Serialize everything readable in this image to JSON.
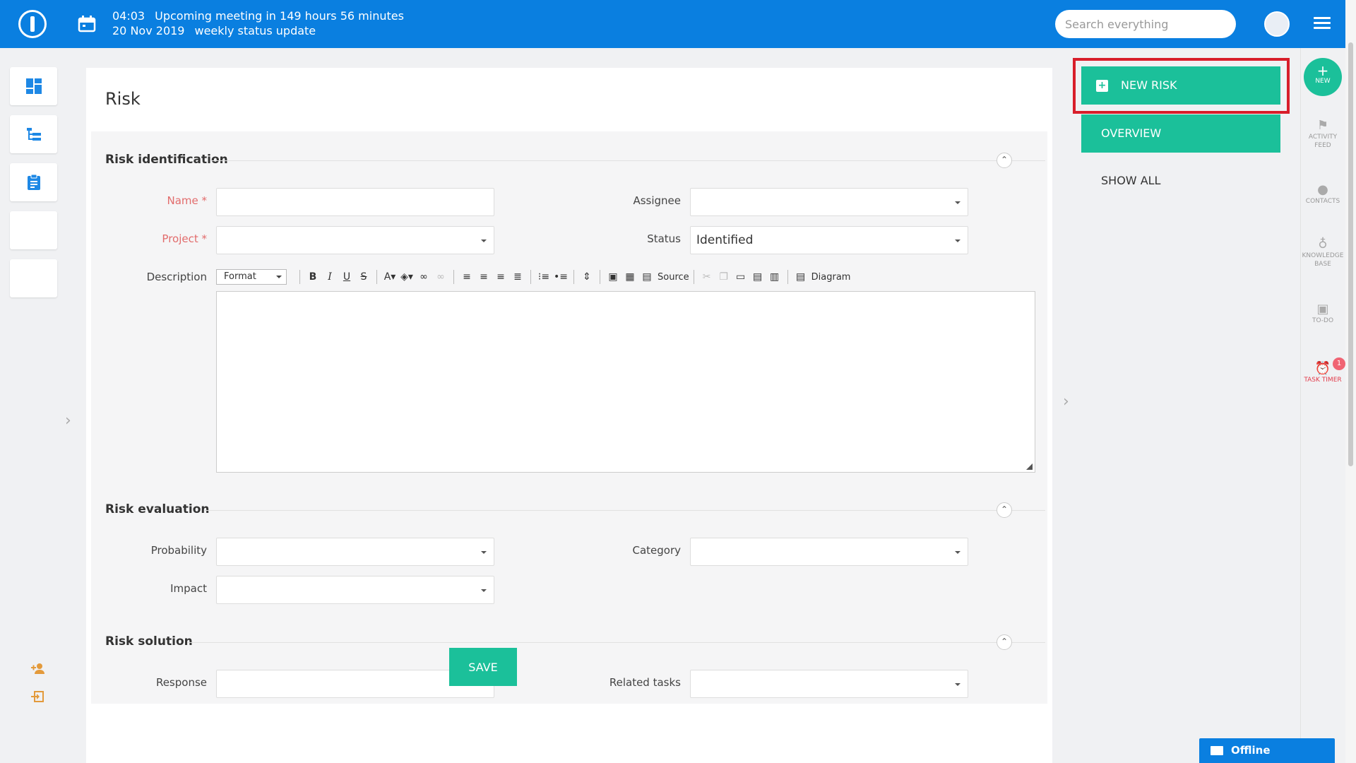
{
  "header": {
    "time": "04:03",
    "meeting": "Upcoming meeting in 149 hours 56 minutes",
    "date": "20 Nov 2019",
    "meeting_name": "weekly status update",
    "search_placeholder": "Search everything"
  },
  "page": {
    "title": "Risk"
  },
  "sections": {
    "identification": "Risk identification",
    "evaluation": "Risk evaluation",
    "solution": "Risk solution"
  },
  "fields": {
    "name_label": "Name *",
    "project_label": "Project *",
    "assignee_label": "Assignee",
    "status_label": "Status",
    "status_value": "Identified",
    "description_label": "Description",
    "probability_label": "Probability",
    "category_label": "Category",
    "impact_label": "Impact",
    "response_label": "Response",
    "related_tasks_label": "Related tasks"
  },
  "toolbar": {
    "format": "Format",
    "source": "Source",
    "diagram": "Diagram"
  },
  "actions": {
    "save": "SAVE",
    "new_risk": "NEW RISK",
    "overview": "OVERVIEW",
    "show_all": "SHOW ALL"
  },
  "rightbar": {
    "new": "NEW",
    "activity_feed": "ACTIVITY FEED",
    "contacts": "CONTACTS",
    "knowledge_base": "KNOWLEDGE BASE",
    "todo": "TO-DO",
    "task_timer": "TASK TIMER",
    "task_timer_badge": "1"
  },
  "chat": {
    "status": "Offline"
  },
  "colors": {
    "topbar": "#0a7fe0",
    "accent": "#1bc09a",
    "highlight": "#d81e2a"
  }
}
